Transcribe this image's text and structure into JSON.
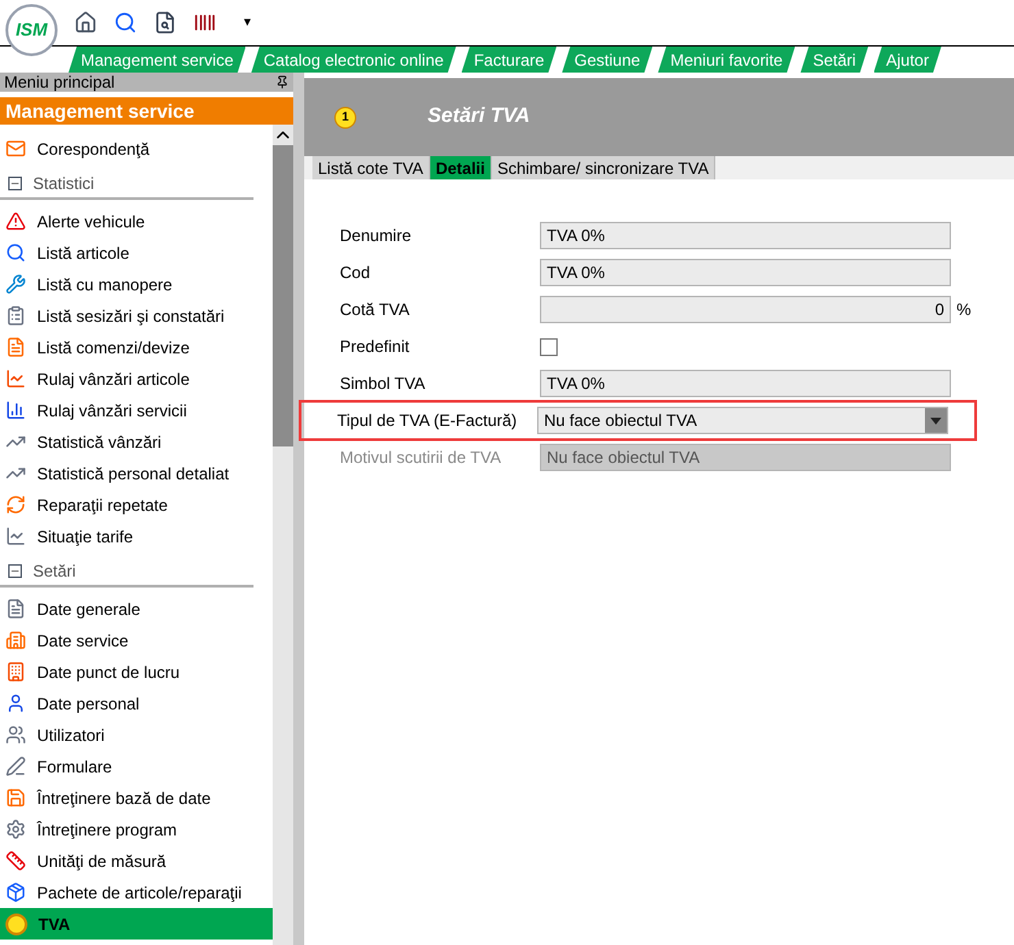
{
  "toolbar": {
    "logo": "ISM",
    "overflow": "▾"
  },
  "menu": [
    {
      "label": "Management service"
    },
    {
      "label": "Catalog electronic online"
    },
    {
      "label": "Facturare"
    },
    {
      "label": "Gestiune"
    },
    {
      "label": "Meniuri favorite"
    },
    {
      "label": "Setări"
    },
    {
      "label": "Ajutor"
    }
  ],
  "sidebar": {
    "title": "Meniu principal",
    "group": "Management service",
    "top_items": [
      {
        "label": "Corespondenţă",
        "selected": false
      }
    ],
    "sections": [
      {
        "title": "Statistici",
        "expanded": true,
        "items": [
          {
            "label": "Alerte vehicule",
            "selected": false
          },
          {
            "label": "Listă articole",
            "selected": false
          },
          {
            "label": "Listă cu manopere",
            "selected": false
          },
          {
            "label": "Listă sesizări şi constatări",
            "selected": false
          },
          {
            "label": "Listă comenzi/devize",
            "selected": false
          },
          {
            "label": "Rulaj vânzări articole",
            "selected": false
          },
          {
            "label": "Rulaj vânzări servicii",
            "selected": false
          },
          {
            "label": "Statistică vânzări",
            "selected": false
          },
          {
            "label": "Statistică personal detaliat",
            "selected": false
          },
          {
            "label": "Reparaţii repetate",
            "selected": false
          },
          {
            "label": "Situaţie tarife",
            "selected": false
          }
        ]
      },
      {
        "title": "Setări",
        "expanded": true,
        "items": [
          {
            "label": "Date generale",
            "selected": false
          },
          {
            "label": "Date service",
            "selected": false
          },
          {
            "label": "Date punct de lucru",
            "selected": false
          },
          {
            "label": "Date personal",
            "selected": false
          },
          {
            "label": "Utilizatori",
            "selected": false
          },
          {
            "label": "Formulare",
            "selected": false
          },
          {
            "label": "Întreţinere bază de date",
            "selected": false
          },
          {
            "label": "Întreţinere program",
            "selected": false
          },
          {
            "label": "Unităţi de măsură",
            "selected": false
          },
          {
            "label": "Pachete de articole/reparaţii",
            "selected": false
          },
          {
            "label": "TVA",
            "selected": true
          }
        ]
      }
    ]
  },
  "page": {
    "badge": "1",
    "title": "Setări TVA",
    "tabs": [
      {
        "label": "Listă cote TVA",
        "selected": false
      },
      {
        "label": "Detalii",
        "selected": true
      },
      {
        "label": "Schimbare/ sincronizare TVA",
        "selected": false
      }
    ],
    "fields": [
      {
        "kind": "text",
        "label": "Denumire",
        "value": "TVA 0%",
        "disabled": false,
        "highlighted": false
      },
      {
        "kind": "text",
        "label": "Cod",
        "value": "TVA 0%",
        "disabled": false,
        "highlighted": false
      },
      {
        "kind": "number",
        "label": "Cotă TVA",
        "value": "0",
        "unit": "%",
        "disabled": false,
        "highlighted": false
      },
      {
        "kind": "checkbox",
        "label": "Predefinit",
        "checked": false,
        "disabled": false,
        "highlighted": false
      },
      {
        "kind": "text",
        "label": "Simbol TVA",
        "value": "TVA 0%",
        "disabled": false,
        "highlighted": false
      },
      {
        "kind": "dropdown",
        "label": "Tipul de TVA (E-Factură)",
        "value": "Nu face obiectul TVA",
        "disabled": false,
        "highlighted": true
      },
      {
        "kind": "text",
        "label": "Motivul scutirii de TVA",
        "value": "Nu face obiectul TVA",
        "disabled": true,
        "highlighted": false
      }
    ]
  }
}
